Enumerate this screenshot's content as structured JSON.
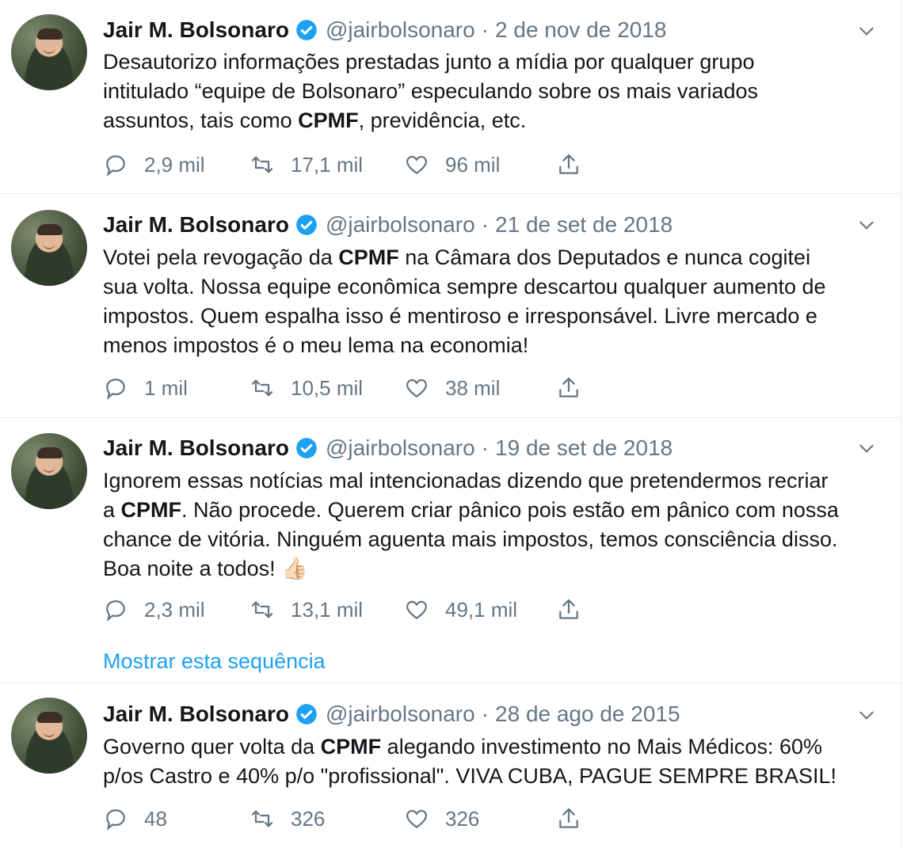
{
  "tweets": [
    {
      "name": "Jair M. Bolsonaro",
      "handle": "@jairbolsonaro",
      "date": "2 de nov de 2018",
      "text_parts": [
        "Desautorizo informações prestadas junto a mídia por qualquer grupo\nintitulado “equipe de Bolsonaro” especulando sobre os mais variados\nassuntos, tais como ",
        "CPMF",
        ", previdência, etc."
      ],
      "replies": "2,9 mil",
      "retweets": "17,1 mil",
      "likes": "96 mil"
    },
    {
      "name": "Jair M. Bolsonaro",
      "handle": "@jairbolsonaro",
      "date": "21 de set de 2018",
      "text_parts": [
        "Votei pela revogação da ",
        "CPMF",
        " na Câmara dos Deputados e nunca cogitei\nsua volta. Nossa equipe econômica sempre descartou qualquer aumento de\nimpostos. Quem espalha isso é mentiroso e irresponsável. Livre mercado e\nmenos impostos é o meu lema na economia!"
      ],
      "replies": "1 mil",
      "retweets": "10,5 mil",
      "likes": "38 mil"
    },
    {
      "name": "Jair M. Bolsonaro",
      "handle": "@jairbolsonaro",
      "date": "19 de set de 2018",
      "text_parts": [
        "Ignorem essas notícias mal intencionadas dizendo que pretendermos recriar\na ",
        "CPMF",
        ". Não procede. Querem criar pânico pois estão em pânico com nossa\nchance de vitória. Ninguém aguenta mais impostos, temos consciência disso.\nBoa noite a todos! 👍🏻"
      ],
      "replies": "2,3 mil",
      "retweets": "13,1 mil",
      "likes": "49,1 mil",
      "thread_link": "Mostrar esta sequência"
    },
    {
      "name": "Jair M. Bolsonaro",
      "handle": "@jairbolsonaro",
      "date": "28 de ago de 2015",
      "text_parts": [
        "Governo quer volta da ",
        "CPMF",
        " alegando investimento no Mais Médicos: 60%\np/os Castro e 40% p/o \"profissional\". VIVA CUBA, PAGUE SEMPRE BRASIL!"
      ],
      "replies": "48",
      "retweets": "326",
      "likes": "326"
    }
  ],
  "separator": "·",
  "colors": {
    "accent": "#1da1f2",
    "muted": "#657786",
    "text": "#14171a",
    "border": "#e6ecf0"
  }
}
